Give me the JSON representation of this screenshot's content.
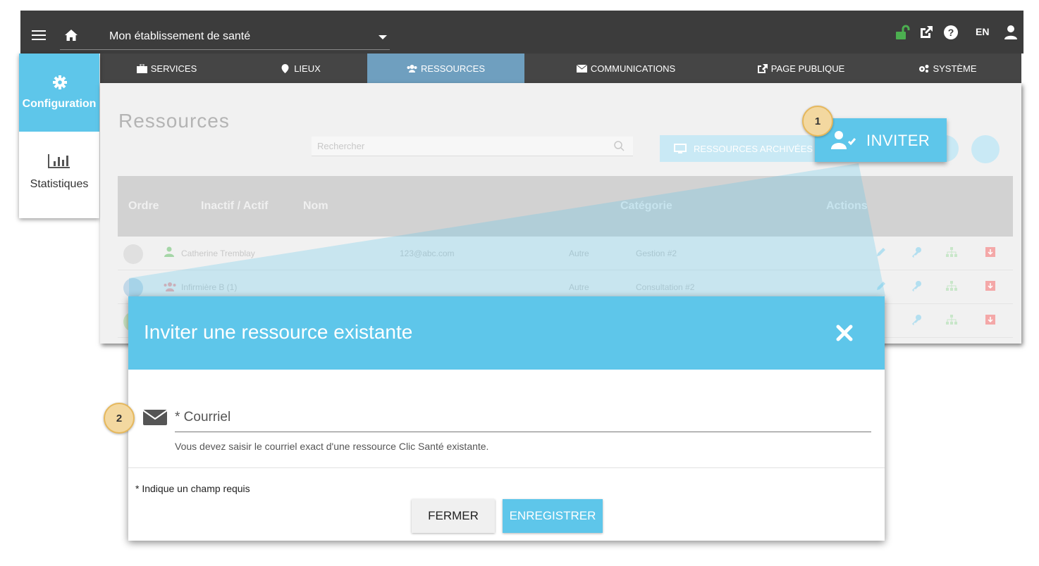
{
  "topbar": {
    "establishment": "Mon établissement de santé",
    "language": "EN"
  },
  "nav": {
    "tabs": [
      {
        "label": "SERVICES",
        "icon": "briefcase-icon"
      },
      {
        "label": "LIEUX",
        "icon": "map-marker-icon"
      },
      {
        "label": "RESSOURCES",
        "icon": "users-icon",
        "active": true
      },
      {
        "label": "COMMUNICATIONS",
        "icon": "envelope-icon"
      },
      {
        "label": "PAGE PUBLIQUE",
        "icon": "external-link-icon"
      },
      {
        "label": "SYSTÈME",
        "icon": "cogs-icon"
      }
    ]
  },
  "sidemenu": {
    "config_label": "Configuration",
    "stats_label": "Statistiques"
  },
  "background": {
    "title": "Ressources",
    "search_placeholder": "Rechercher",
    "archived_label": "RESSOURCES ARCHIVÉES",
    "columns": [
      "Ordre",
      "Inactif / Actif",
      "Nom",
      "Catégorie",
      "Actions"
    ],
    "rows": [
      {
        "name": "Catherine Tremblay",
        "email": "123@abc.com",
        "type": "Autre",
        "category": "Gestion #2"
      },
      {
        "name": "Infirmière B (1)",
        "email": "",
        "type": "Autre",
        "category": "Consultation #2"
      }
    ]
  },
  "invite": {
    "label": "INVITER",
    "badge1": "1",
    "badge2": "2"
  },
  "modal": {
    "title": "Inviter une ressource existante",
    "email_label": "* Courriel",
    "email_help": "Vous devez saisir le courriel exact d'une ressource Clic Santé existante.",
    "required_note": "* Indique un champ requis",
    "close_label": "FERMER",
    "save_label": "ENREGISTRER"
  },
  "colors": {
    "accent": "#5ec6ea",
    "topbar": "#3c3c3c",
    "lock_green": "#4caf50",
    "badge": "#f3d8a0"
  }
}
